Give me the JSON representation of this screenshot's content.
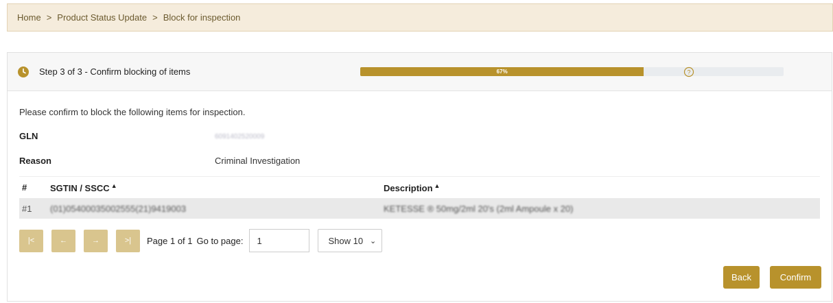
{
  "breadcrumb": {
    "items": [
      "Home",
      "Product Status Update",
      "Block for inspection"
    ],
    "separator": ">"
  },
  "step": {
    "title": "Step 3 of 3 - Confirm blocking of items",
    "progress_label": "67%",
    "progress_value": 0.67,
    "icon": "clock-icon",
    "help_icon": "help-circle-icon"
  },
  "content": {
    "instruction": "Please confirm to block the following items for inspection.",
    "gln_label": "GLN",
    "gln_value": "6091402520009",
    "reason_label": "Reason",
    "reason_value": "Criminal Investigation"
  },
  "table": {
    "headers": [
      "#",
      "SGTIN / SSCC",
      "Description"
    ],
    "sort_icon": "caret-up-icon",
    "rows": [
      [
        "#1",
        "(01)05400035002555(21)9419003",
        "KETESSE ® 50mg/2ml 20's (2ml Ampoule x 20)"
      ]
    ]
  },
  "pager": {
    "first": "|<",
    "prev": "←",
    "next": "→",
    "last": ">|",
    "page_text": "Page 1 of 1",
    "goto_label": "Go to page:",
    "goto_value": "1",
    "show_value": "Show 10"
  },
  "actions": {
    "back": "Back",
    "confirm": "Confirm"
  },
  "colors": {
    "accent": "#b8922c",
    "breadcrumb_bg": "#f5ecdc",
    "disabled_button": "#d9c58e"
  }
}
